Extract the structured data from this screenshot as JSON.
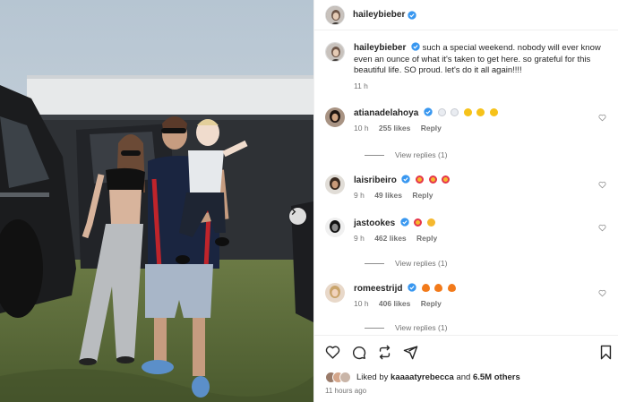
{
  "post": {
    "author": "haileybieber",
    "caption_author": "haileybieber",
    "caption": "such a special weekend. nobody will ever know even an ounce of what it's taken to get here. so grateful for this beautiful life. SO proud. let's do it all again!!!!",
    "caption_time": "11 h"
  },
  "comments": [
    {
      "user": "atianadelahoya",
      "time": "10 h",
      "likes": "255 likes",
      "reply": "Reply",
      "view_replies": "View replies (1)",
      "emojis": [
        "white-heart",
        "white-heart",
        "sun",
        "sun",
        "sun"
      ]
    },
    {
      "user": "laisribeiro",
      "time": "9 h",
      "likes": "49 likes",
      "reply": "Reply",
      "view_replies": "",
      "emojis": [
        "heart-eyes",
        "heart-eyes",
        "heart-eyes"
      ]
    },
    {
      "user": "jastookes",
      "time": "9 h",
      "likes": "462 likes",
      "reply": "Reply",
      "view_replies": "View replies (1)",
      "emojis": [
        "heart-eyes",
        "grinning"
      ]
    },
    {
      "user": "romeestrijd",
      "time": "10 h",
      "likes": "406 likes",
      "reply": "Reply",
      "view_replies": "View replies (1)",
      "emojis": [
        "fire",
        "fire",
        "fire"
      ]
    }
  ],
  "likes": {
    "prefix": "Liked by",
    "user": "kaaaatyrebecca",
    "and": "and",
    "count": "6.5M others"
  },
  "post_time": "11 hours ago",
  "icons": {
    "like": "heart-icon",
    "comment": "comment-icon",
    "share": "repost-icon",
    "send": "send-icon",
    "save": "bookmark-icon",
    "next": "chevron-right-icon",
    "verified": "verified-badge-icon"
  },
  "colors": {
    "verified": "#3897f0",
    "muted": "#737373",
    "text": "#262626",
    "grass": "#5d6e3b",
    "fence": "#2c2f33"
  }
}
